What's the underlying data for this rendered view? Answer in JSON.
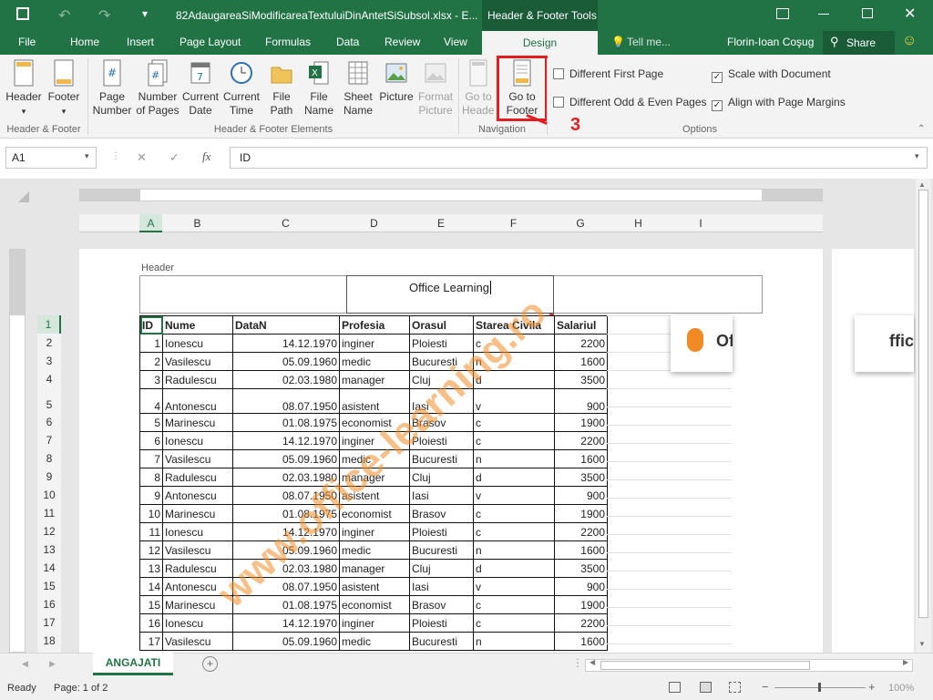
{
  "window": {
    "title": "82AdaugareaSiModificareaTextuluiDinAntetSiSubsol.xlsx - E...",
    "context_tools": "Header & Footer Tools",
    "user": "Florin-Ioan Coşug",
    "tell_me": "Tell me...",
    "share": "Share"
  },
  "tabs": [
    "File",
    "Home",
    "Insert",
    "Page Layout",
    "Formulas",
    "Data",
    "Review",
    "View",
    "Design"
  ],
  "ribbon": {
    "header_label": "Header",
    "footer_label": "Footer",
    "page_number": "Page Number",
    "number_of_pages": "Number of Pages",
    "current_date": "Current Date",
    "current_time": "Current Time",
    "file_path": "File Path",
    "file_name": "File Name",
    "sheet_name": "Sheet Name",
    "picture": "Picture",
    "format_picture": "Format Picture",
    "go_to_header": "Go to Header",
    "go_to_footer": "Go to Footer",
    "groups": {
      "hf": "Header & Footer",
      "elements": "Header & Footer Elements",
      "nav": "Navigation",
      "options": "Options"
    },
    "options": {
      "diff_first": "Different First Page",
      "diff_odd_even": "Different Odd & Even Pages",
      "scale_doc": "Scale with Document",
      "align_margins": "Align with Page Margins"
    }
  },
  "callout": "3",
  "formula": {
    "namebox": "A1",
    "content": "ID"
  },
  "columns": [
    "A",
    "B",
    "C",
    "D",
    "E",
    "F",
    "G",
    "H",
    "I"
  ],
  "header_area": {
    "label": "Header",
    "center_text": "Office Learning"
  },
  "table": {
    "headers": [
      "ID",
      "Nume",
      "DataN",
      "Profesia",
      "Orasul",
      "Starea Civila",
      "Salariul"
    ],
    "rows": [
      [
        "1",
        "Ionescu",
        "14.12.1970",
        "inginer",
        "Ploiesti",
        "c",
        "2200"
      ],
      [
        "2",
        "Vasilescu",
        "05.09.1960",
        "medic",
        "Bucuresti",
        "n",
        "1600"
      ],
      [
        "3",
        "Radulescu",
        "02.03.1980",
        "manager",
        "Cluj",
        "d",
        "3500"
      ],
      [
        "4",
        "Antonescu",
        "08.07.1950",
        "asistent",
        "Iasi",
        "v",
        "900"
      ],
      [
        "5",
        "Marinescu",
        "01.08.1975",
        "economist",
        "Brasov",
        "c",
        "1900"
      ],
      [
        "6",
        "Ionescu",
        "14.12.1970",
        "inginer",
        "Ploiesti",
        "c",
        "2200"
      ],
      [
        "7",
        "Vasilescu",
        "05.09.1960",
        "medic",
        "Bucuresti",
        "n",
        "1600"
      ],
      [
        "8",
        "Radulescu",
        "02.03.1980",
        "manager",
        "Cluj",
        "d",
        "3500"
      ],
      [
        "9",
        "Antonescu",
        "08.07.1950",
        "asistent",
        "Iasi",
        "v",
        "900"
      ],
      [
        "10",
        "Marinescu",
        "01.08.1975",
        "economist",
        "Brasov",
        "c",
        "1900"
      ],
      [
        "11",
        "Ionescu",
        "14.12.1970",
        "inginer",
        "Ploiesti",
        "c",
        "2200"
      ],
      [
        "12",
        "Vasilescu",
        "05.09.1960",
        "medic",
        "Bucuresti",
        "n",
        "1600"
      ],
      [
        "13",
        "Radulescu",
        "02.03.1980",
        "manager",
        "Cluj",
        "d",
        "3500"
      ],
      [
        "14",
        "Antonescu",
        "08.07.1950",
        "asistent",
        "Iasi",
        "v",
        "900"
      ],
      [
        "15",
        "Marinescu",
        "01.08.1975",
        "economist",
        "Brasov",
        "c",
        "1900"
      ],
      [
        "16",
        "Ionescu",
        "14.12.1970",
        "inginer",
        "Ploiesti",
        "c",
        "2200"
      ],
      [
        "17",
        "Vasilescu",
        "05.09.1960",
        "medic",
        "Bucuresti",
        "n",
        "1600"
      ]
    ]
  },
  "row_numbers": [
    "1",
    "2",
    "3",
    "4",
    "5",
    "6",
    "7",
    "8",
    "9",
    "10",
    "11",
    "12",
    "13",
    "14",
    "15",
    "16",
    "17",
    "18"
  ],
  "sheet_tab": "ANGAJATI",
  "status": {
    "ready": "Ready",
    "page": "Page: 1 of 2",
    "zoom": "100%"
  },
  "watermark": "www.office-learning.ro",
  "colors": {
    "excel_green": "#217346",
    "callout_red": "#e02020"
  }
}
